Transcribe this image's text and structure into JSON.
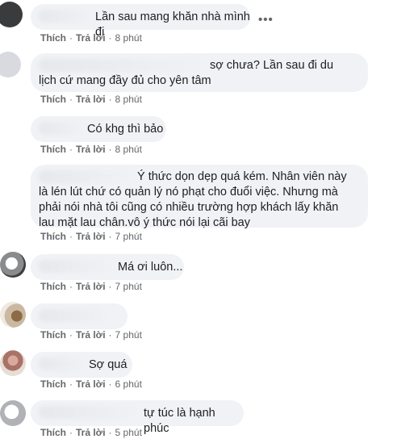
{
  "comments": [
    {
      "text": "Lần sau mang khăn nhà mình đi",
      "like": "Thích",
      "reply": "Trả lời",
      "time": "8 phút"
    },
    {
      "text": "sợ chưa? Lần sau đi du lịch cứ mang đầy đủ cho yên tâm",
      "like": "Thích",
      "reply": "Trả lời",
      "time": "8 phút"
    },
    {
      "text": "Có khg thì bảo",
      "like": "Thích",
      "reply": "Trả lời",
      "time": "8 phút"
    },
    {
      "text": "Ý thức dọn dẹp quá kém. Nhân viên này là lén lút chứ có quản lý nó phạt cho đuổi việc. Nhưng mà phải nói nhà tôi cũng có nhiều trường hợp khách lấy khăn lau mặt lau chân.vô ý thức nói lại cãi bay",
      "like": "Thích",
      "reply": "Trả lời",
      "time": "7 phút"
    },
    {
      "text": "Má ơi luôn...",
      "like": "Thích",
      "reply": "Trả lời",
      "time": "7 phút"
    },
    {
      "text": "",
      "like": "Thích",
      "reply": "Trả lời",
      "time": "7 phút"
    },
    {
      "text": "Sợ quá",
      "like": "Thích",
      "reply": "Trả lời",
      "time": "6 phút"
    },
    {
      "text": "tự túc là hạnh phúc",
      "like": "Thích",
      "reply": "Trả lời",
      "time": "5 phút"
    }
  ],
  "more_label": "•••",
  "icons": {
    "more": "more-options-icon"
  }
}
